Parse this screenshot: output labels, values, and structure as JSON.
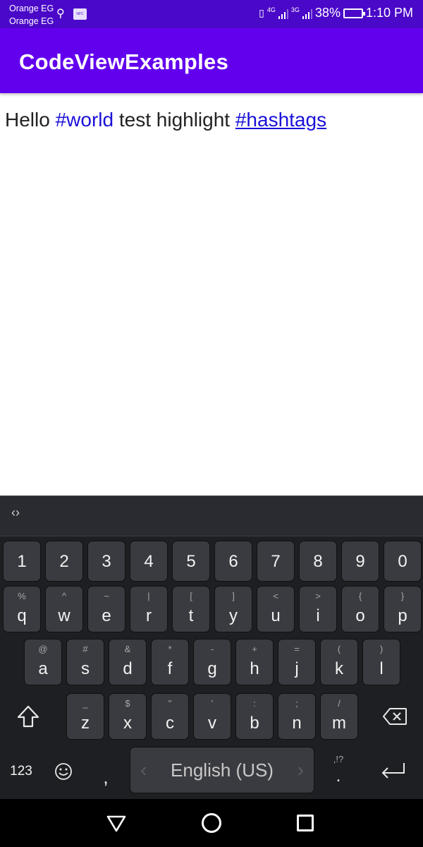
{
  "status_bar": {
    "carrier_1": "Orange EG",
    "carrier_2": "Orange EG",
    "net_1": "4G",
    "net_2": "3G",
    "battery": "38%",
    "time": "1:10 PM"
  },
  "app_bar": {
    "title": "CodeViewExamples"
  },
  "content": {
    "word1": "Hello",
    "tag1": "#world",
    "word2": "test highlight",
    "tag2": "#hashtags"
  },
  "keyboard": {
    "number_row": [
      "1",
      "2",
      "3",
      "4",
      "5",
      "6",
      "7",
      "8",
      "9",
      "0"
    ],
    "row1": [
      {
        "main": "q",
        "sub": "%"
      },
      {
        "main": "w",
        "sub": "^"
      },
      {
        "main": "e",
        "sub": "~"
      },
      {
        "main": "r",
        "sub": "|"
      },
      {
        "main": "t",
        "sub": "["
      },
      {
        "main": "y",
        "sub": "]"
      },
      {
        "main": "u",
        "sub": "<"
      },
      {
        "main": "i",
        "sub": ">"
      },
      {
        "main": "o",
        "sub": "{"
      },
      {
        "main": "p",
        "sub": "}"
      }
    ],
    "row2": [
      {
        "main": "a",
        "sub": "@"
      },
      {
        "main": "s",
        "sub": "#"
      },
      {
        "main": "d",
        "sub": "&"
      },
      {
        "main": "f",
        "sub": "*"
      },
      {
        "main": "g",
        "sub": "-"
      },
      {
        "main": "h",
        "sub": "+"
      },
      {
        "main": "j",
        "sub": "="
      },
      {
        "main": "k",
        "sub": "("
      },
      {
        "main": "l",
        "sub": ")"
      }
    ],
    "row3": [
      {
        "main": "z",
        "sub": "_"
      },
      {
        "main": "x",
        "sub": "$"
      },
      {
        "main": "c",
        "sub": "\""
      },
      {
        "main": "v",
        "sub": "'"
      },
      {
        "main": "b",
        "sub": ":"
      },
      {
        "main": "n",
        "sub": ";"
      },
      {
        "main": "m",
        "sub": "/"
      }
    ],
    "symbols_label": "123",
    "comma_label": ",",
    "space_label": "English (US)",
    "period_label": ".",
    "period_sub": ",!?"
  },
  "icons": {
    "toolbar": "expand-toggle-icon",
    "shift": "shift-icon",
    "backspace": "backspace-icon",
    "emoji": "emoji-icon",
    "enter": "enter-icon",
    "back": "back-triangle-icon",
    "home": "home-circle-icon",
    "recents": "recents-square-icon"
  },
  "colors": {
    "status_bar": "#4a08c8",
    "app_bar": "#6200ee",
    "hashtag": "#1a10d8",
    "keyboard_bg": "#1e1f23",
    "key_bg": "#3a3b40"
  }
}
